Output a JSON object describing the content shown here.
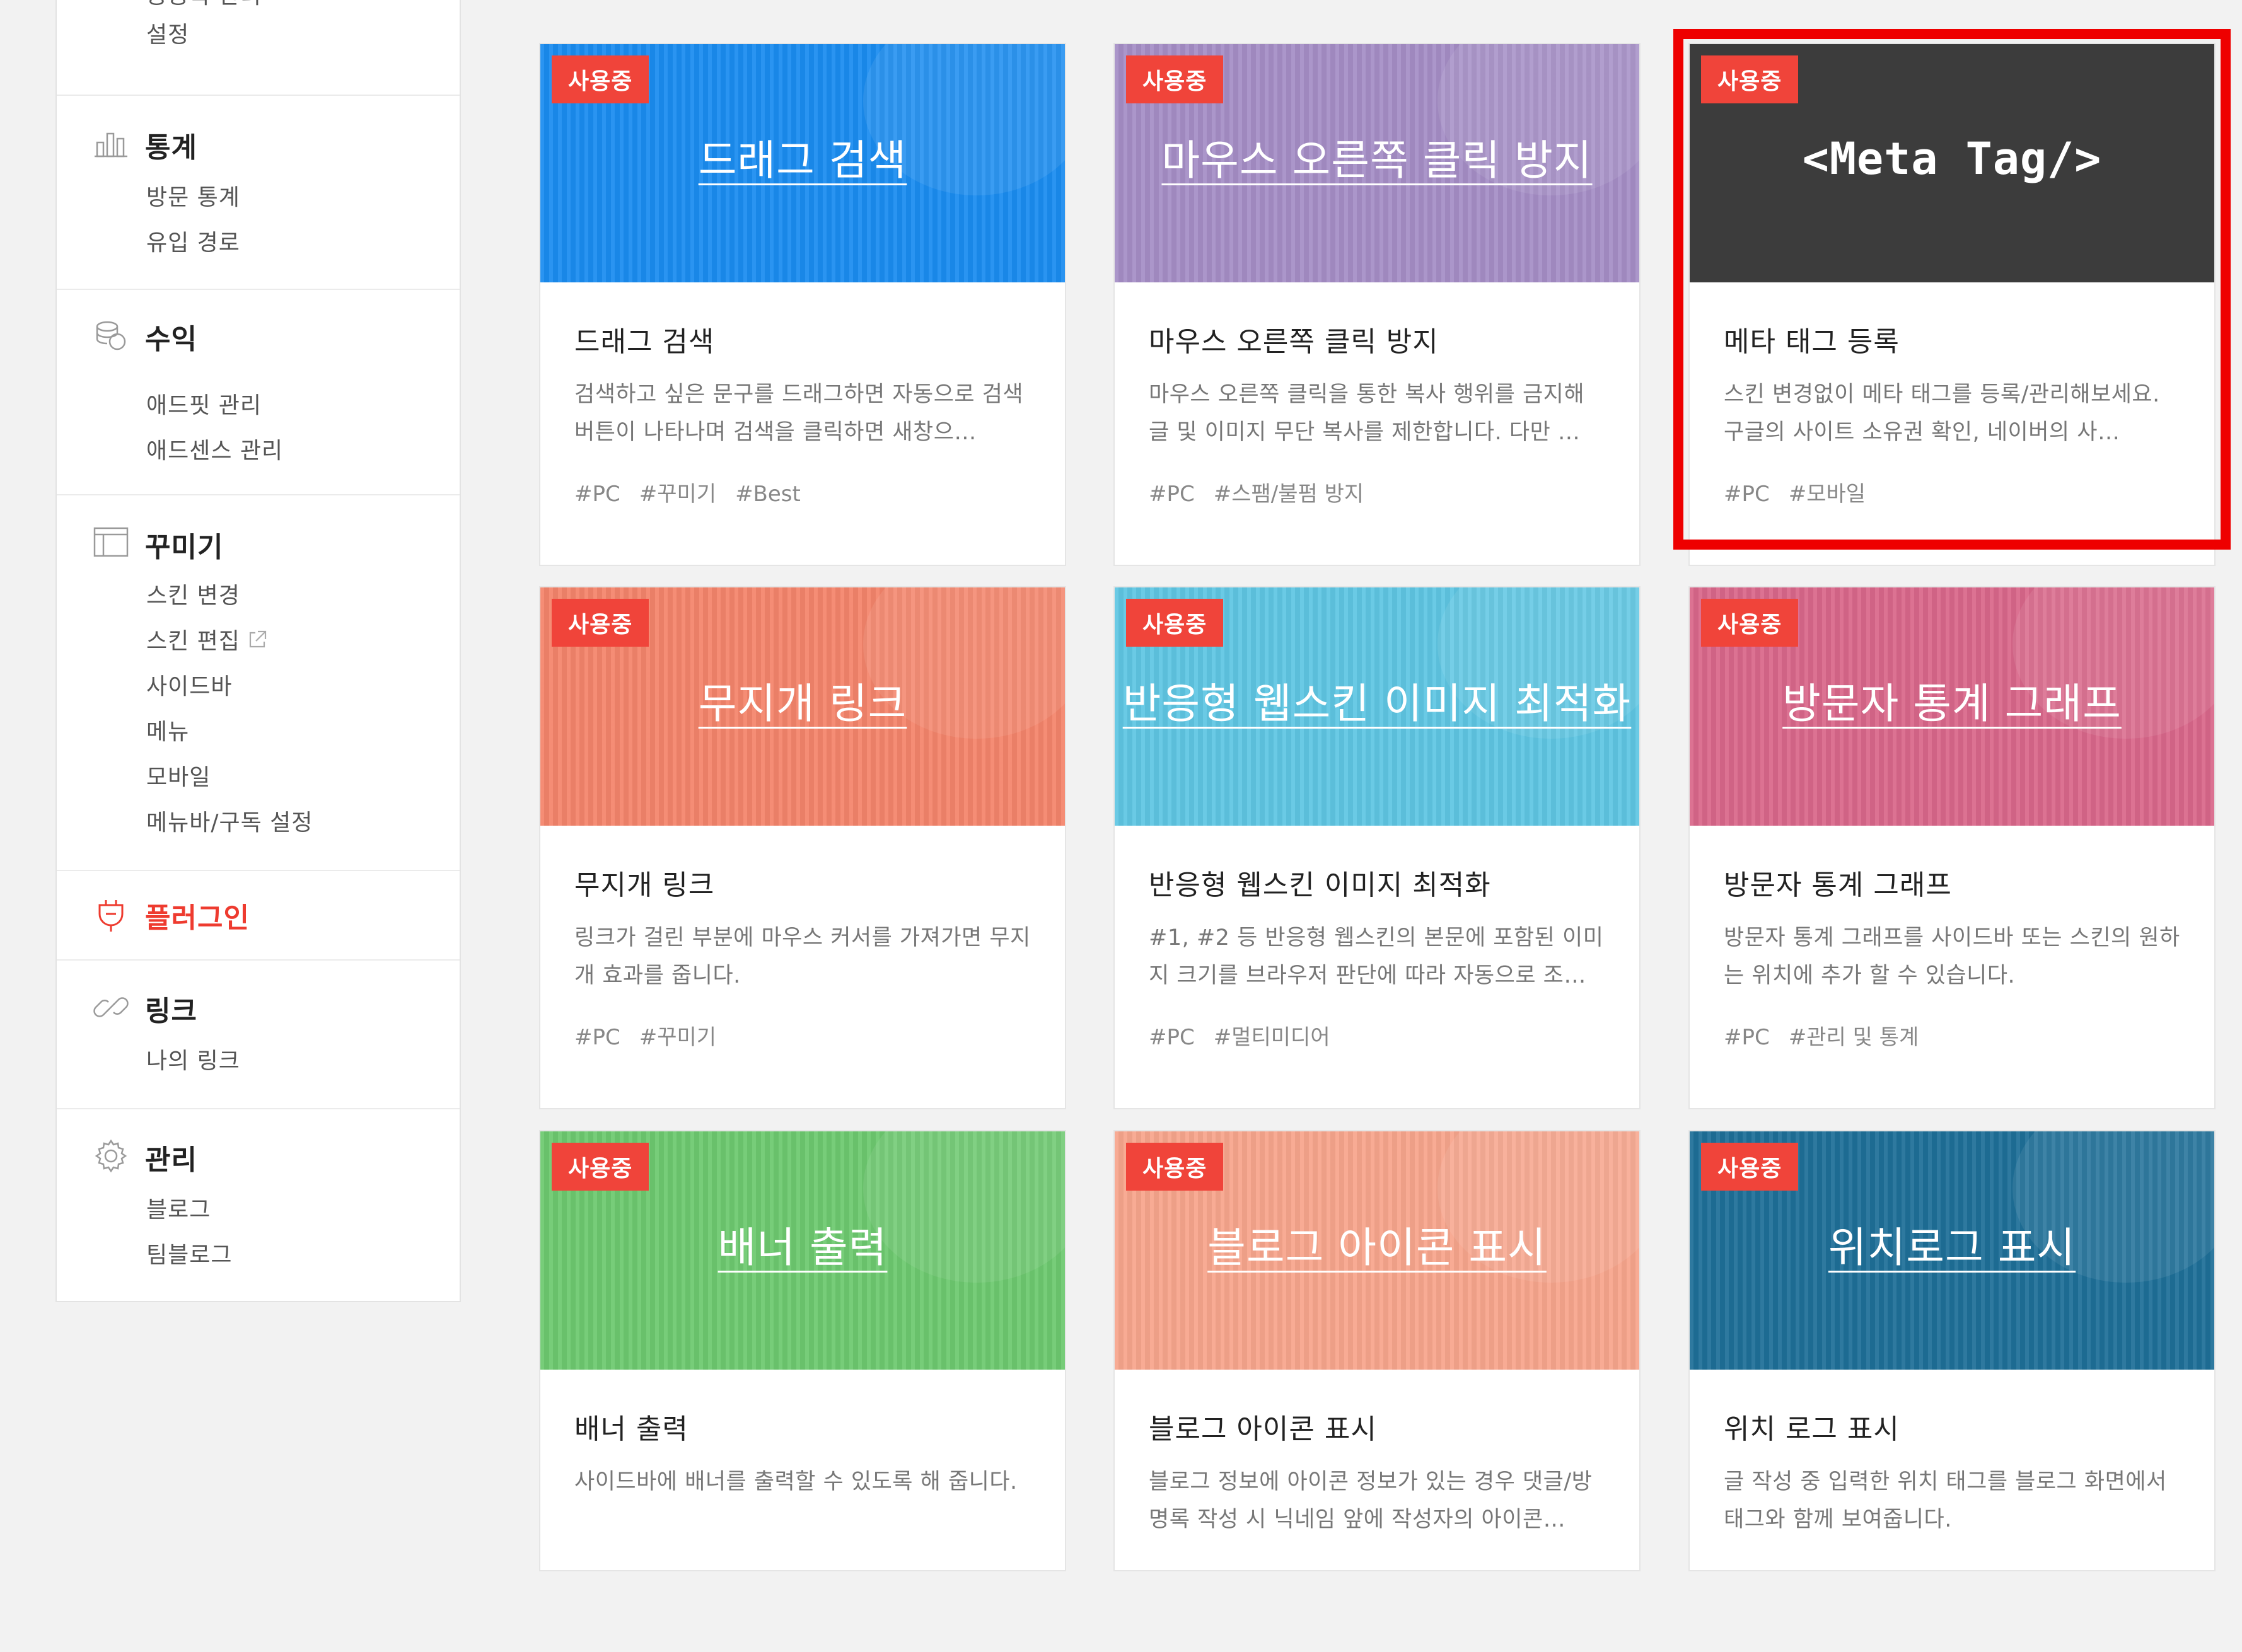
{
  "sidebar": {
    "top_partial": "공공목 관리",
    "top_settings": "설정",
    "sections": [
      {
        "icon": "bar-chart-icon",
        "title": "통계",
        "items": [
          "방문 통계",
          "유입 경로"
        ]
      },
      {
        "icon": "coins-icon",
        "title": "수익",
        "items": [
          "애드핏 관리",
          "애드센스 관리"
        ]
      },
      {
        "icon": "layout-icon",
        "title": "꾸미기",
        "items": [
          "스킨 변경",
          "스킨 편집",
          "사이드바",
          "메뉴",
          "모바일",
          "메뉴바/구독 설정"
        ]
      },
      {
        "icon": "plug-icon",
        "title": "플러그인",
        "items": []
      },
      {
        "icon": "link-icon",
        "title": "링크",
        "items": [
          "나의 링크"
        ]
      },
      {
        "icon": "gear-icon",
        "title": "관리",
        "items": [
          "블로그",
          "팀블로그"
        ]
      }
    ]
  },
  "badge_label": "사용중",
  "cards": [
    {
      "thumb_title": "드래그 검색",
      "name": "드래그 검색",
      "desc": "검색하고 싶은 문구를 드래그하면 자동으로 검색 버튼이 나타나며 검색을 클릭하면 새창으…",
      "tags": [
        "#PC",
        "#꾸미기",
        "#Best"
      ],
      "color": "#1a8cf0"
    },
    {
      "thumb_title": "마우스 오른쪽 클릭 방지",
      "name": "마우스 오른쪽 클릭 방지",
      "desc": "마우스 오른쪽 클릭을 통한 복사 행위를 금지해 글 및 이미지 무단 복사를 제한합니다. 다만 …",
      "tags": [
        "#PC",
        "#스팸/불펌 방지"
      ],
      "color": "#a58ec6"
    },
    {
      "thumb_title": "<Meta Tag/>",
      "name": "메타 태그 등록",
      "desc": "스킨 변경없이 메타 태그를 등록/관리해보세요. 구글의 사이트 소유권 확인, 네이버의 사…",
      "tags": [
        "#PC",
        "#모바일"
      ],
      "color": "#3c3c3c"
    },
    {
      "thumb_title": "무지개 링크",
      "name": "무지개 링크",
      "desc": "링크가 걸린 부분에 마우스 커서를 가져가면 무지개 효과를 줍니다.",
      "tags": [
        "#PC",
        "#꾸미기"
      ],
      "color": "#f4846b"
    },
    {
      "thumb_title": "반응형 웹스킨 이미지 최적화",
      "name": "반응형 웹스킨 이미지 최적화",
      "desc": "#1, #2 등 반응형 웹스킨의 본문에 포함된 이미지 크기를 브라우저 판단에 따라 자동으로 조…",
      "tags": [
        "#PC",
        "#멀티미디어"
      ],
      "color": "#5fc6e3"
    },
    {
      "thumb_title": "방문자 통계 그래프",
      "name": "방문자 통계 그래프",
      "desc": "방문자 통계 그래프를 사이드바 또는 스킨의 원하는 위치에 추가 할 수 있습니다.",
      "tags": [
        "#PC",
        "#관리 및 통계"
      ],
      "color": "#d9678a"
    },
    {
      "thumb_title": "배너 출력",
      "name": "배너 출력",
      "desc": "사이드바에 배너를 출력할 수 있도록 해 줍니다.",
      "tags": [],
      "color": "#6dc96f"
    },
    {
      "thumb_title": "블로그 아이콘 표시",
      "name": "블로그 아이콘 표시",
      "desc": "블로그 정보에 아이콘 정보가 있는 경우 댓글/방명록 작성 시 닉네임 앞에 작성자의 아이콘…",
      "tags": [],
      "color": "#f7a58c"
    },
    {
      "thumb_title": "위치로그 표시",
      "name": "위치 로그 표시",
      "desc": "글 작성 중 입력한 위치 태그를 블로그 화면에서 태그와 함께 보여줍니다.",
      "tags": [],
      "color": "#1e6f98"
    }
  ]
}
